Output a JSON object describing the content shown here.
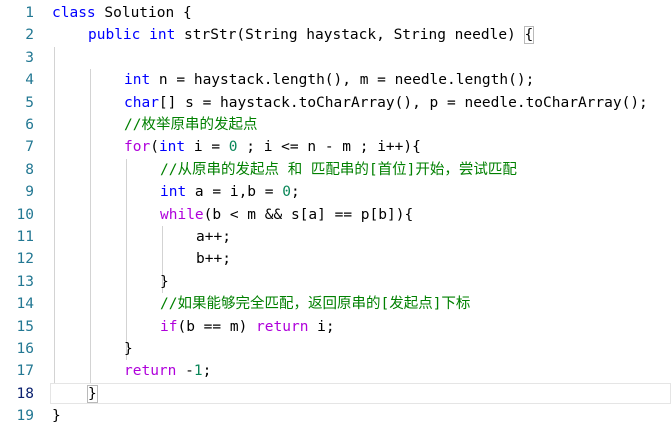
{
  "editor": {
    "current_line": 18,
    "lines": [
      {
        "n": "1",
        "indent": 0,
        "tokens": [
          [
            "kw",
            "class"
          ],
          [
            "p",
            " Solution {"
          ]
        ]
      },
      {
        "n": "2",
        "indent": 1,
        "tokens": [
          [
            "kw",
            "public"
          ],
          [
            "p",
            " "
          ],
          [
            "kw",
            "int"
          ],
          [
            "p",
            " strStr(String haystack, String needle) "
          ],
          [
            "bx",
            "{"
          ]
        ]
      },
      {
        "n": "3",
        "indent": 0,
        "tokens": []
      },
      {
        "n": "4",
        "indent": 2,
        "tokens": [
          [
            "kw",
            "int"
          ],
          [
            "p",
            " n = haystack.length(), m = needle.length();"
          ]
        ]
      },
      {
        "n": "5",
        "indent": 2,
        "tokens": [
          [
            "kw",
            "char"
          ],
          [
            "p",
            "[] s = haystack.toCharArray(), p = needle.toCharArray();"
          ]
        ]
      },
      {
        "n": "6",
        "indent": 2,
        "tokens": [
          [
            "cm",
            "//枚举原串的发起点"
          ]
        ]
      },
      {
        "n": "7",
        "indent": 2,
        "tokens": [
          [
            "ctl",
            "for"
          ],
          [
            "p",
            "("
          ],
          [
            "kw",
            "int"
          ],
          [
            "p",
            " i = "
          ],
          [
            "num",
            "0"
          ],
          [
            "p",
            " ; i <= n - m ; i++){"
          ]
        ]
      },
      {
        "n": "8",
        "indent": 3,
        "tokens": [
          [
            "cm",
            "//从原串的发起点 和 匹配串的[首位]开始，尝试匹配"
          ]
        ]
      },
      {
        "n": "9",
        "indent": 3,
        "tokens": [
          [
            "kw",
            "int"
          ],
          [
            "p",
            " a = i,b = "
          ],
          [
            "num",
            "0"
          ],
          [
            "p",
            ";"
          ]
        ]
      },
      {
        "n": "10",
        "indent": 3,
        "tokens": [
          [
            "ctl",
            "while"
          ],
          [
            "p",
            "(b < m && s[a] == p[b]){"
          ]
        ]
      },
      {
        "n": "11",
        "indent": 4,
        "tokens": [
          [
            "p",
            "a++;"
          ]
        ]
      },
      {
        "n": "12",
        "indent": 4,
        "tokens": [
          [
            "p",
            "b++;"
          ]
        ]
      },
      {
        "n": "13",
        "indent": 3,
        "tokens": [
          [
            "p",
            "}"
          ]
        ]
      },
      {
        "n": "14",
        "indent": 3,
        "tokens": [
          [
            "cm",
            "//如果能够完全匹配，返回原串的[发起点]下标"
          ]
        ]
      },
      {
        "n": "15",
        "indent": 3,
        "tokens": [
          [
            "ctl",
            "if"
          ],
          [
            "p",
            "(b == m) "
          ],
          [
            "ctl",
            "return"
          ],
          [
            "p",
            " i;"
          ]
        ]
      },
      {
        "n": "16",
        "indent": 2,
        "tokens": [
          [
            "p",
            "}"
          ]
        ]
      },
      {
        "n": "17",
        "indent": 2,
        "tokens": [
          [
            "ctl",
            "return"
          ],
          [
            "p",
            " -"
          ],
          [
            "num",
            "1"
          ],
          [
            "p",
            ";"
          ]
        ]
      },
      {
        "n": "18",
        "indent": 1,
        "tokens": [
          [
            "bx",
            "}"
          ],
          [
            "cur",
            ""
          ]
        ]
      },
      {
        "n": "19",
        "indent": 0,
        "tokens": [
          [
            "p",
            "}"
          ]
        ]
      }
    ]
  }
}
